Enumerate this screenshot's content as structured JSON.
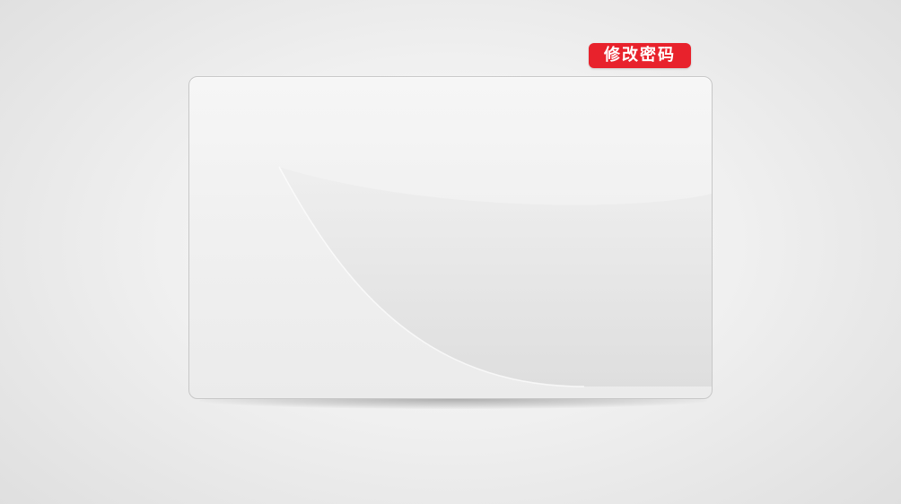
{
  "header": {
    "tab_label": "修改密码"
  },
  "colors": {
    "accent": "#e8222c",
    "card_background": "#f1f1f1",
    "page_background": "#ececec"
  },
  "main": {
    "panel": "change-password-form-panel"
  }
}
